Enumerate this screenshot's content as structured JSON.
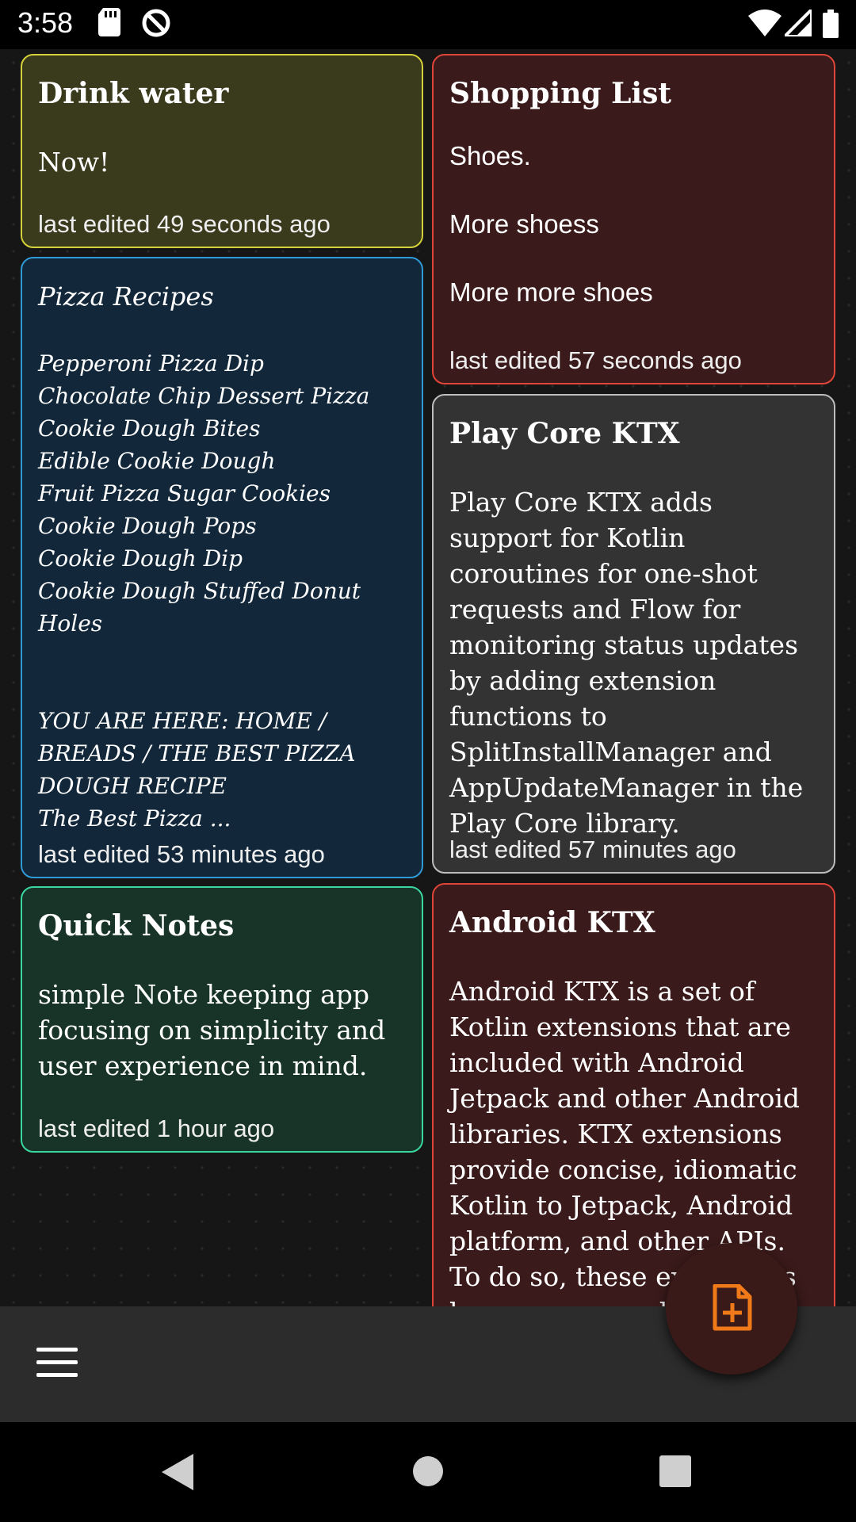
{
  "status": {
    "time": "3:58"
  },
  "notes": [
    {
      "title": "Drink water",
      "body": "Now!",
      "time": "last edited 49 seconds ago",
      "border": "#d4d13a",
      "bg": "#3a3a1c"
    },
    {
      "title": "Shopping List",
      "body": "Shoes.\nMore shoess\nMore more shoes",
      "time": "last edited 57 seconds ago",
      "border": "#e0453a",
      "bg": "#3a1a1a"
    },
    {
      "title": "Pizza Recipes",
      "body": "Pepperoni Pizza Dip\nChocolate Chip Dessert Pizza\nCookie Dough Bites\nEdible Cookie Dough\nFruit Pizza Sugar Cookies\nCookie Dough Pops\nCookie Dough Dip\nCookie Dough Stuffed Donut Holes\n\n\nYOU ARE HERE: HOME /\nBREADS / THE BEST PIZZA\nDOUGH RECIPE\nThe Best Pizza ...",
      "time": "last edited 53 minutes ago",
      "border": "#2f9ad8",
      "bg": "#12283a"
    },
    {
      "title": "Play Core KTX",
      "body": "Play Core KTX adds support for Kotlin coroutines for one-shot requests and Flow for monitoring status updates by adding extension functions to SplitInstallManager and AppUpdateManager in the Play Core library.",
      "time": "last edited 57 minutes ago",
      "border": "#bdbdbd",
      "bg": "#333333"
    },
    {
      "title": "Quick Notes",
      "body": "simple Note keeping app focusing on simplicity and user experience in mind.",
      "time": "last edited 1 hour ago",
      "border": "#3ad8a0",
      "bg": "#183428"
    },
    {
      "title": "Android KTX",
      "body": "Android KTX is a set of Kotlin extensions that are included with Android Jetpack and other Android libraries. KTX extensions provide concise, idiomatic Kotlin to Jetpack, Android platform, and other APIs. To do so, these extensions leverage several",
      "time": "",
      "border": "#e0453a",
      "bg": "#3a1a1a"
    }
  ],
  "icons": {
    "menu": "hamburger-menu-icon",
    "fab": "add-note-icon",
    "fab_color": "#f07a1a"
  }
}
